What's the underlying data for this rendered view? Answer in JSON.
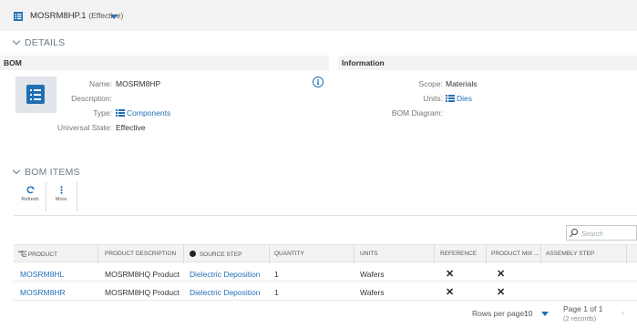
{
  "header": {
    "title": "MOSRM8HP.1",
    "subtitle": "(Effective)"
  },
  "details": {
    "toggle_label": "DETAILS",
    "bom_header": "BOM",
    "info_header": "Information",
    "fields": {
      "name_label": "Name:",
      "name_value": "MOSRM8HP",
      "description_label": "Description:",
      "description_value": "",
      "type_label": "Type:",
      "type_value": "Components",
      "universal_state_label": "Universal State:",
      "universal_state_value": "Effective",
      "scope_label": "Scope:",
      "scope_value": "Materials",
      "units_label": "Units:",
      "units_value": "Dies",
      "bom_diagram_label": "BOM Diagram:",
      "bom_diagram_value": ""
    }
  },
  "bom_items": {
    "toggle_label": "BOM ITEMS",
    "toolbar": {
      "refresh_label": "Refresh",
      "more_label": "More"
    },
    "search_placeholder": "Search",
    "columns": [
      "PRODUCT",
      "PRODUCT DESCRIPTION",
      "SOURCE STEP",
      "QUANTITY",
      "UNITS",
      "REFERENCE",
      "PRODUCT MIX ...",
      "ASSEMBLY STEP"
    ],
    "rows": [
      {
        "product": "MOSRM8HL",
        "description": "MOSRM8HQ Product",
        "source_step": "Dielectric Deposition",
        "quantity": "1",
        "units": "Wafers",
        "reference": "✕",
        "product_mix": "✕",
        "assembly_step": ""
      },
      {
        "product": "MOSRM8HR",
        "description": "MOSRM8HQ Product",
        "source_step": "Dielectric Deposition",
        "quantity": "1",
        "units": "Wafers",
        "reference": "✕",
        "product_mix": "✕",
        "assembly_step": ""
      }
    ],
    "footer": {
      "rows_per_page_label": "Rows per page:",
      "rows_per_page_value": "10",
      "page_label": "Page 1 of 1",
      "records_label": "(2 records)"
    }
  },
  "colors": {
    "accent": "#1f6fb5",
    "header_bg": "#f3f3f3"
  }
}
